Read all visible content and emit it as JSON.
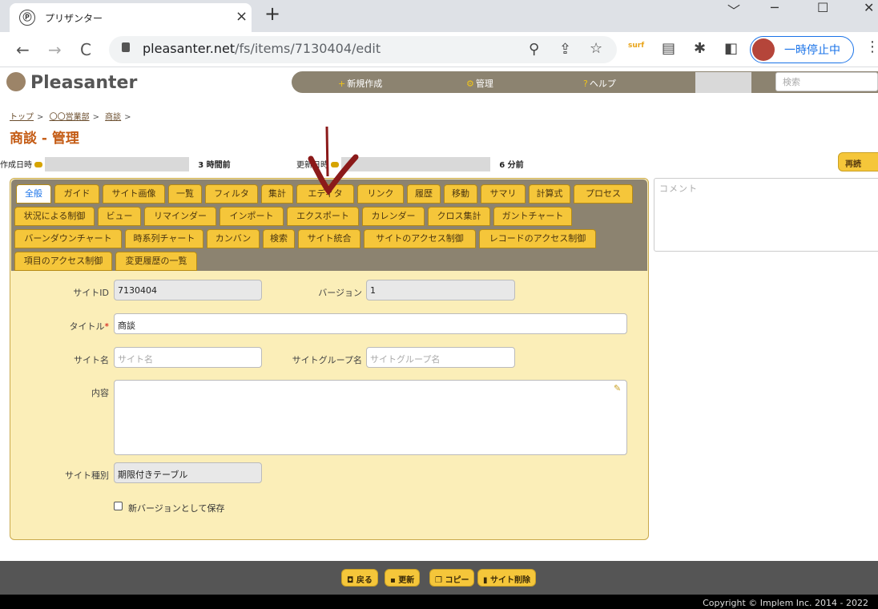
{
  "browser": {
    "tab_favicon": "Ⓟ",
    "tab_title": "プリザンター",
    "close_glyph": "×",
    "newtab_glyph": "+",
    "window_controls": {
      "chevron": "﹀",
      "minimize": "─",
      "maximize": "☐",
      "close": "✕"
    },
    "url_host": "pleasanter.net",
    "url_path": "/fs/items/7130404/edit",
    "nav": {
      "back": "←",
      "forward": "→",
      "reload": "C"
    },
    "icons": {
      "zoom": "⚲",
      "share": "⇪",
      "bookmark": "☆",
      "extension_surf": "surf",
      "reader": "▤",
      "puzzle": "✱",
      "sidepanel": "◧"
    },
    "profile_pause_label": "一時停止中",
    "menu_glyph": "⋮"
  },
  "app": {
    "logo_text": "Pleasanter",
    "menu": {
      "new": "新規作成",
      "manage": "管理",
      "help": "ヘルプ"
    },
    "menu_prefix": {
      "new": "+",
      "manage": "⚙",
      "help": "?"
    },
    "search_placeholder": "検索",
    "breadcrumb": [
      "トップ",
      "〇〇営業部",
      "商談"
    ],
    "breadcrumb_sep": ">",
    "page_title": "商談 - 管理",
    "created_label": "作成日時",
    "created_value": "3 時間前",
    "updated_label": "更新日時",
    "updated_value": "6 分前",
    "reload_label": "再読",
    "comment_placeholder": "コメント"
  },
  "tabs": [
    "全般",
    "ガイド",
    "サイト画像",
    "一覧",
    "フィルタ",
    "集計",
    "エディタ",
    "リンク",
    "履歴",
    "移動",
    "サマリ",
    "計算式",
    "プロセス",
    "状況による制御",
    "ビュー",
    "リマインダー",
    "インポート",
    "エクスポート",
    "カレンダー",
    "クロス集計",
    "ガントチャート",
    "バーンダウンチャート",
    "時系列チャート",
    "カンバン",
    "検索",
    "サイト統合",
    "サイトのアクセス制御",
    "レコードのアクセス制御",
    "項目のアクセス制御",
    "変更履歴の一覧"
  ],
  "form": {
    "site_id_label": "サイトID",
    "site_id_value": "7130404",
    "version_label": "バージョン",
    "version_value": "1",
    "title_label": "タイトル",
    "title_required_mark": "*",
    "title_value": "商談",
    "site_name_label": "サイト名",
    "site_name_placeholder": "サイト名",
    "site_group_label": "サイトグループ名",
    "site_group_placeholder": "サイトグループ名",
    "content_label": "内容",
    "site_type_label": "サイト種別",
    "site_type_value": "期限付きテーブル",
    "new_version_label": "新バージョンとして保存"
  },
  "footer": {
    "back": "戻る",
    "update": "更新",
    "copy": "コピー",
    "delete": "サイト削除",
    "copyright": "Copyright © Implem Inc. 2014 - 2022"
  },
  "colors": {
    "accent": "#f5c63a",
    "title": "#c45b14",
    "menubar": "#8c8370",
    "annotation_arrow": "#8b1a1a"
  }
}
